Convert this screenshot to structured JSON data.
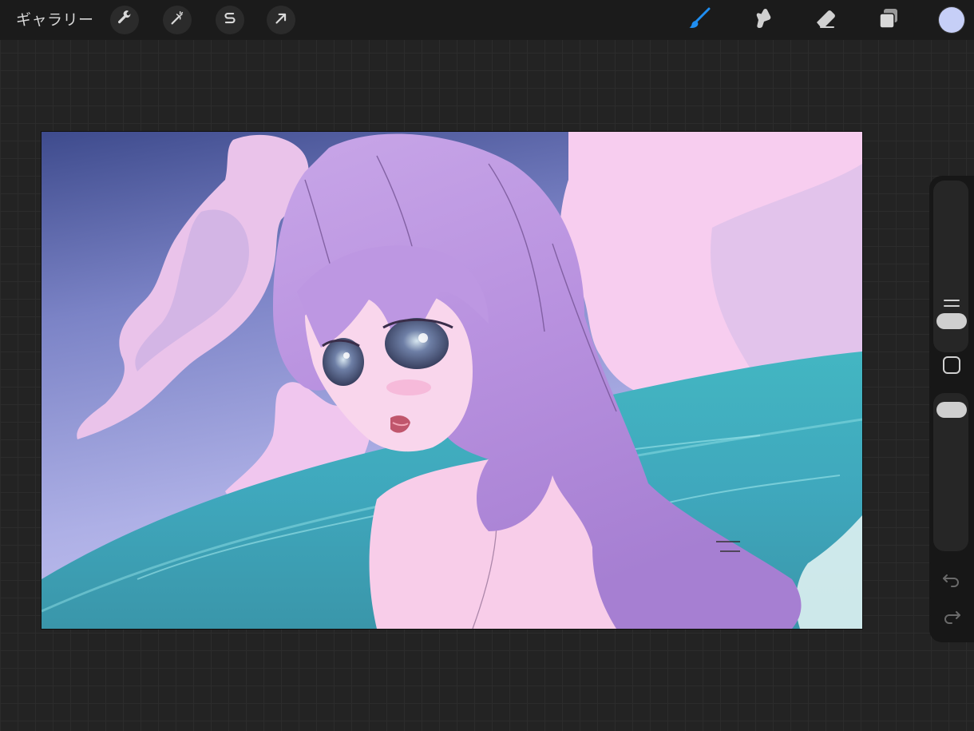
{
  "app": {
    "gallery_label": "ギャラリー"
  },
  "toolbar_left": [
    {
      "name": "actions-button",
      "icon": "wrench-icon"
    },
    {
      "name": "adjustments-button",
      "icon": "magic-wand-icon"
    },
    {
      "name": "selection-button",
      "icon": "selection-s-icon"
    },
    {
      "name": "transform-button",
      "icon": "arrow-cursor-icon"
    }
  ],
  "toolbar_right": [
    {
      "name": "brush-button",
      "icon": "brush-icon",
      "active": true
    },
    {
      "name": "smudge-button",
      "icon": "smudge-icon",
      "active": false
    },
    {
      "name": "eraser-button",
      "icon": "eraser-icon",
      "active": false
    },
    {
      "name": "layers-button",
      "icon": "layers-icon",
      "active": false
    }
  ],
  "colors": {
    "accent": "#1f8ef1",
    "current_color": "#c6cff7",
    "toolbar_bg": "#1b1b1b",
    "canvas_bg": "#232323"
  },
  "sidebar": {
    "brush_size_slider": {
      "icon": "grip-icon"
    },
    "modify_button": {
      "icon": "square-icon"
    },
    "opacity_slider": {},
    "undo": {
      "icon": "undo-icon"
    },
    "redo": {
      "icon": "redo-icon"
    }
  }
}
